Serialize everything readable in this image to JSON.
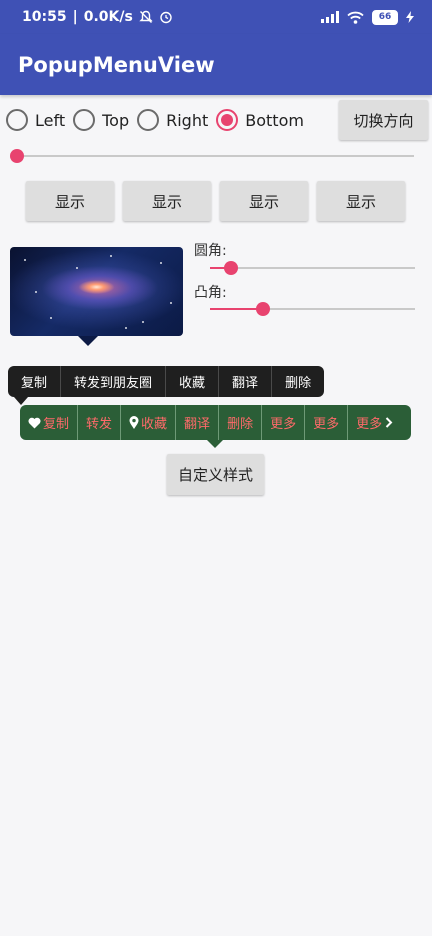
{
  "status_bar": {
    "time": "10:55",
    "speed": "0.0K/s",
    "battery": "66"
  },
  "app_bar": {
    "title": "PopupMenuView"
  },
  "direction_radios": [
    {
      "label": "Left",
      "checked": false
    },
    {
      "label": "Top",
      "checked": false
    },
    {
      "label": "Right",
      "checked": false
    },
    {
      "label": "Bottom",
      "checked": true
    }
  ],
  "switch_direction_label": "切换方向",
  "top_slider": {
    "value": 0.0
  },
  "show_buttons": [
    "显示",
    "显示",
    "显示",
    "显示"
  ],
  "corner": {
    "label": "圆角:",
    "value": 0.1
  },
  "bulge": {
    "label": "凸角:",
    "value": 0.26
  },
  "dark_menu": [
    "复制",
    "转发到朋友圈",
    "收藏",
    "翻译",
    "删除"
  ],
  "green_menu": [
    {
      "label": "复制",
      "icon": "heart-icon"
    },
    {
      "label": "转发"
    },
    {
      "label": "收藏",
      "icon": "location-pin-icon"
    },
    {
      "label": "翻译"
    },
    {
      "label": "删除"
    },
    {
      "label": "更多"
    },
    {
      "label": "更多"
    },
    {
      "label": "更多",
      "icon_after": "chevron-right-icon"
    }
  ],
  "custom_style_label": "自定义样式",
  "colors": {
    "primary": "#3f51b5",
    "accent": "#e8436f",
    "dark_menu_bg": "#1f1f1f",
    "green_menu_bg": "#2b5e37",
    "green_menu_text": "#ff6a6a"
  }
}
